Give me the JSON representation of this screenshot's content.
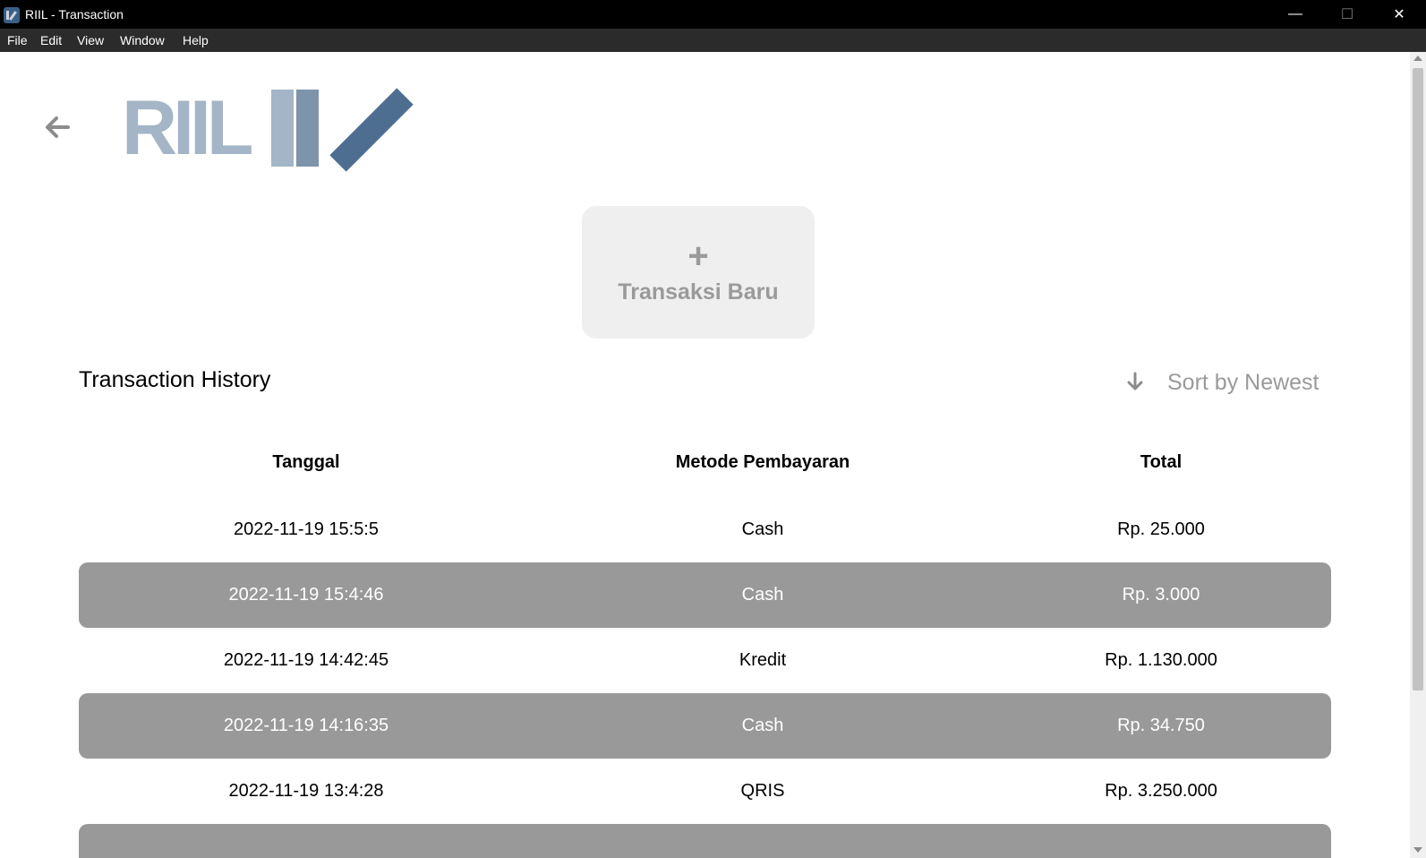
{
  "window": {
    "title": "RIIL - Transaction",
    "minimize_glyph": "—",
    "maximize_glyph": "☐",
    "close_glyph": "✕"
  },
  "menu": [
    "File",
    "Edit",
    "View",
    "Window",
    "Help"
  ],
  "logo": {
    "text": "RIIL"
  },
  "new_transaction": {
    "icon": "plus-icon",
    "plus": "+",
    "label": "Transaksi Baru"
  },
  "history": {
    "title": "Transaction History",
    "sort_label": "Sort by Newest",
    "sort_icon": "arrow-down-icon",
    "columns": [
      "Tanggal",
      "Metode Pembayaran",
      "Total"
    ],
    "rows": [
      {
        "tanggal": "2022-11-19 15:5:5",
        "metode": "Cash",
        "total": "Rp. 25.000"
      },
      {
        "tanggal": "2022-11-19 15:4:46",
        "metode": "Cash",
        "total": "Rp. 3.000"
      },
      {
        "tanggal": "2022-11-19 14:42:45",
        "metode": "Kredit",
        "total": "Rp. 1.130.000"
      },
      {
        "tanggal": "2022-11-19 14:16:35",
        "metode": "Cash",
        "total": "Rp. 34.750"
      },
      {
        "tanggal": "2022-11-19 13:4:28",
        "metode": "QRIS",
        "total": "Rp. 3.250.000"
      },
      {
        "tanggal": "",
        "metode": "",
        "total": ""
      }
    ]
  },
  "colors": {
    "row_alt": "#999999",
    "logo_light": "#a3b5c6",
    "logo_mid": "#7d94ab",
    "logo_dark": "#4d6e91",
    "button_bg": "#efefef"
  }
}
